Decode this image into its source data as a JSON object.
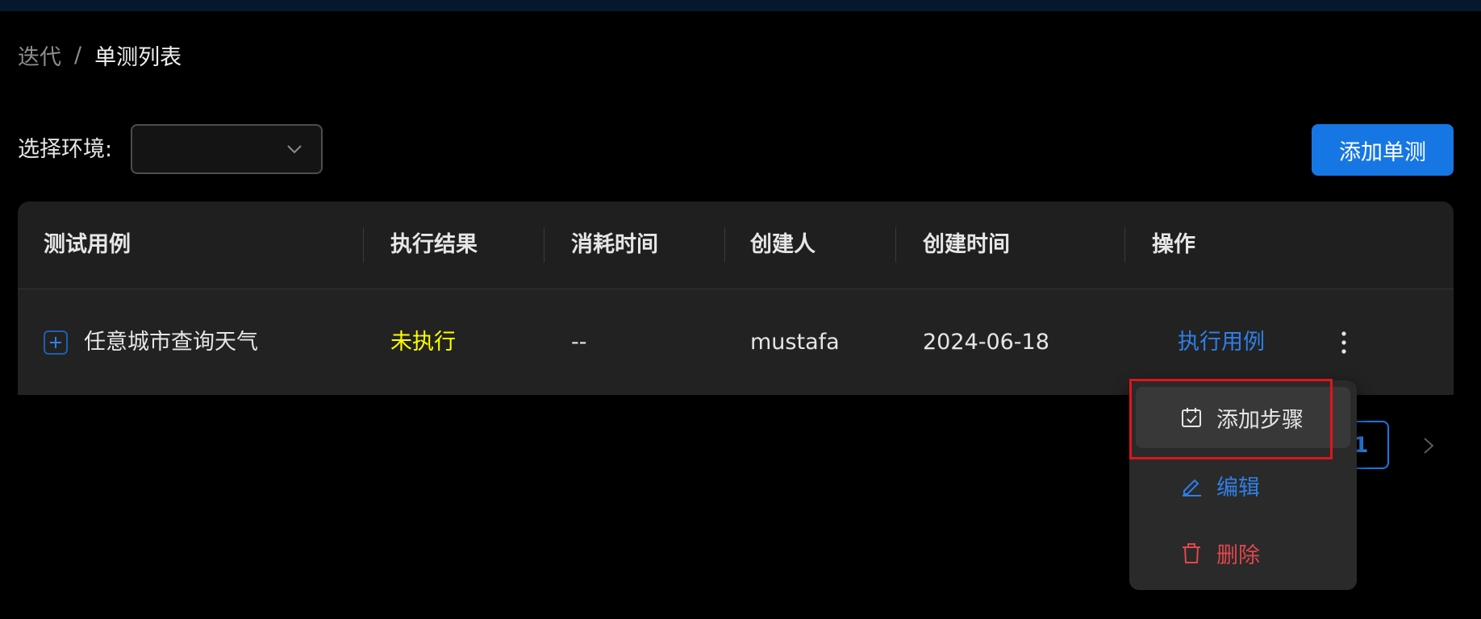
{
  "breadcrumb": {
    "parent": "迭代",
    "separator": "/",
    "current": "单测列表"
  },
  "env": {
    "label": "选择环境:",
    "value": ""
  },
  "add_button_label": "添加单测",
  "table": {
    "columns": [
      "测试用例",
      "执行结果",
      "消耗时间",
      "创建人",
      "创建时间",
      "操作"
    ],
    "rows": [
      {
        "name": "任意城市查询天气",
        "result": "未执行",
        "duration": "--",
        "creator": "mustafa",
        "created": "2024-06-18",
        "action": "执行用例"
      }
    ]
  },
  "pagination": {
    "current_page": "1"
  },
  "menu": {
    "items": [
      {
        "label": "添加步骤",
        "icon": "calendar-check-icon"
      },
      {
        "label": "编辑",
        "icon": "pencil-icon"
      },
      {
        "label": "删除",
        "icon": "trash-icon"
      }
    ]
  },
  "colors": {
    "accent": "#1677e4",
    "status_pending": "#ffff00",
    "danger": "#e0474c",
    "highlight": "#e0141c"
  }
}
